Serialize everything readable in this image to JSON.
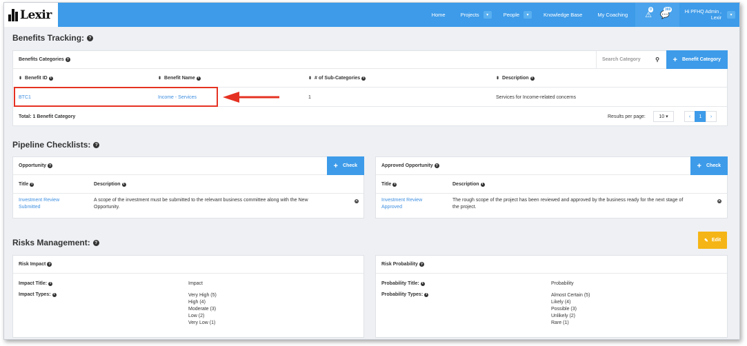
{
  "nav": {
    "logo_text": "Lexir",
    "links": [
      "Home",
      "Projects",
      "People",
      "Knowledge Base",
      "My Coaching"
    ],
    "alerts_badge": "0",
    "messages_badge": "369",
    "user_greeting": "Hi PFHQ Admin ,",
    "user_org": "Lexir"
  },
  "benefits": {
    "section_title": "Benefits Tracking:",
    "panel_title": "Benefits Categories",
    "search_placeholder": "Search Category",
    "add_button": "Benefit Category",
    "columns": [
      "Benefit ID",
      "Benefit Name",
      "# of Sub-Categories",
      "Description"
    ],
    "rows": [
      {
        "id": "BTC1",
        "name": "Income - Services",
        "subcount": "1",
        "description": "Services for Income-related concerns"
      }
    ],
    "total": "Total: 1 Benefit Category",
    "results_label": "Results per page:",
    "per_page": "10",
    "page": "1"
  },
  "pipeline": {
    "section_title": "Pipeline Checklists:",
    "check_label": "Check",
    "title_col": "Title",
    "desc_col": "Description",
    "opportunity": {
      "panel_title": "Opportunity",
      "item_title_1": "Investment Review",
      "item_title_2": "Submitted",
      "desc_1": "A scope of the investment must be submitted to the relevant business committee along with the New",
      "desc_2": "Opportunity."
    },
    "approved": {
      "panel_title": "Approved Opportunity",
      "item_title_1": "Investment Review",
      "item_title_2": "Approved",
      "desc_1": "The rough scope of the project has been reviewed and approved by the business ready for the next stage of",
      "desc_2": "the project."
    }
  },
  "risks": {
    "section_title": "Risks Management:",
    "edit_label": "Edit",
    "impact": {
      "panel_title": "Risk Impact",
      "title_label": "Impact Title:",
      "title_value": "Impact",
      "types_label": "Impact Types:",
      "types": [
        "Very High (5)",
        "High (4)",
        "Moderate (3)",
        "Low (2)",
        "Very Low (1)"
      ]
    },
    "probability": {
      "panel_title": "Risk Probability",
      "title_label": "Probability Title:",
      "title_value": "Probability",
      "types_label": "Probability Types:",
      "types": [
        "Almost Certain (5)",
        "Likely (4)",
        "Possible (3)",
        "Unlikely (2)",
        "Rare (1)"
      ]
    }
  },
  "colors": {
    "primary": "#3d9be9",
    "link": "#3d8ee0",
    "highlight": "#e53122",
    "edit": "#f5b516"
  }
}
